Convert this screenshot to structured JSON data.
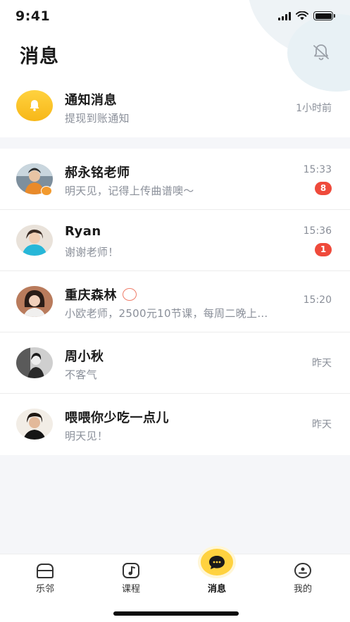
{
  "status_bar": {
    "time": "9:41"
  },
  "header": {
    "title": "消息"
  },
  "notice": {
    "name": "通知消息",
    "message": "提现到账通知",
    "time": "1小时前"
  },
  "chats": [
    {
      "name": "郝永铭老师",
      "message": "明天见，记得上传曲谱噢～",
      "time": "15:33",
      "badge": "8"
    },
    {
      "name": "Ryan",
      "message": "谢谢老师！",
      "time": "15:36",
      "badge": "1"
    },
    {
      "name": "重庆森林",
      "message": "小欧老师，2500元10节课，每周二晚上…",
      "time": "15:20",
      "badge": ""
    },
    {
      "name": "周小秋",
      "message": "不客气",
      "time": "昨天",
      "badge": ""
    },
    {
      "name": "喂喂你少吃一点儿",
      "message": "明天见！",
      "time": "昨天",
      "badge": ""
    }
  ],
  "tabbar": {
    "tabs": [
      {
        "label": "乐邻"
      },
      {
        "label": "课程"
      },
      {
        "label": "消息"
      },
      {
        "label": "我的"
      }
    ]
  },
  "colors": {
    "accent": "#ffd23f",
    "badge": "#ef4a3b",
    "muted": "#8a8f99"
  }
}
